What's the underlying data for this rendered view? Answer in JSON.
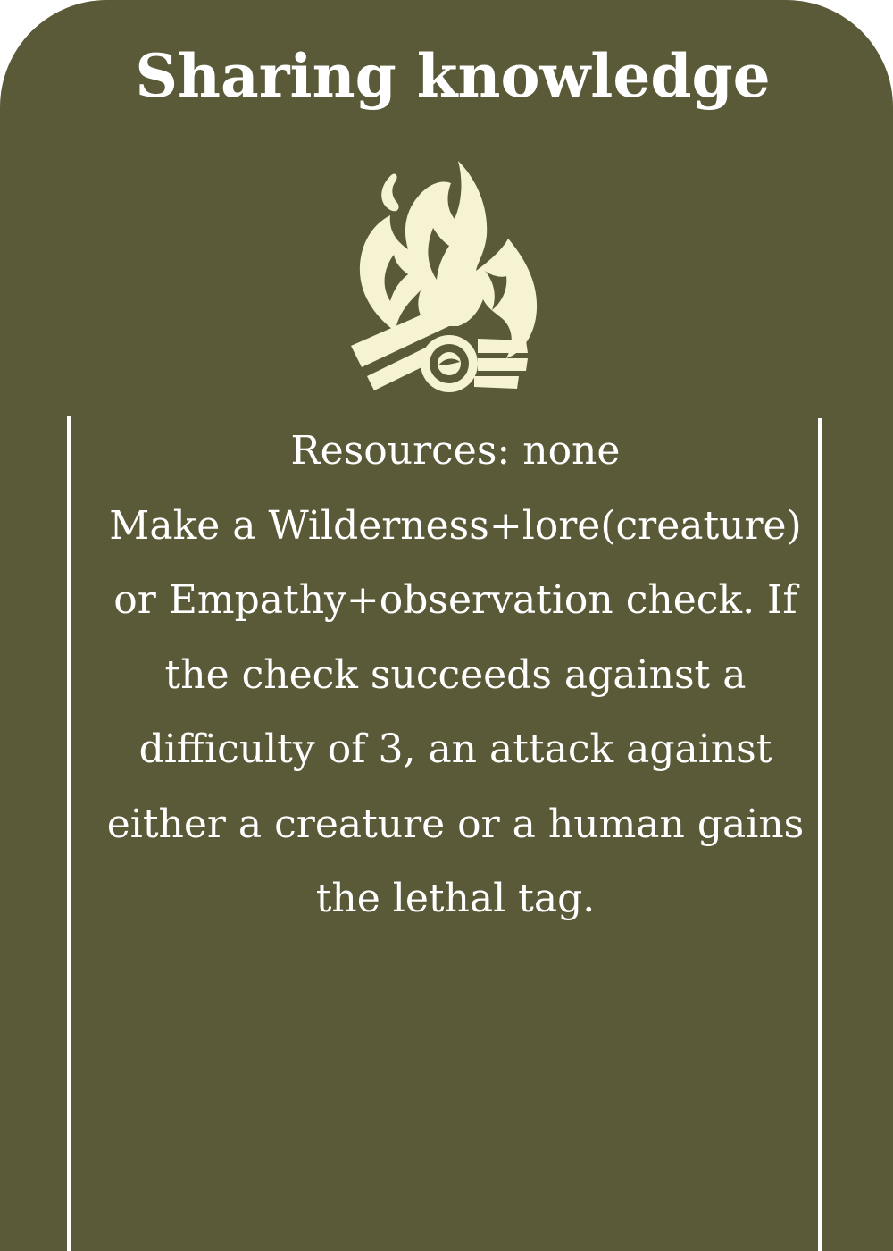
{
  "card": {
    "title": "Sharing knowledge",
    "icon": "campfire-icon",
    "resources_line": "Resources: none",
    "description": "Make a Wilderness+lore(creature) or Empathy+observation check. If the check succeeds against a difficulty of 3, an attack against either a creature or a human gains the lethal tag."
  },
  "colors": {
    "background": "#5a5938",
    "text": "#ffffff",
    "icon": "#f6f3d2"
  }
}
